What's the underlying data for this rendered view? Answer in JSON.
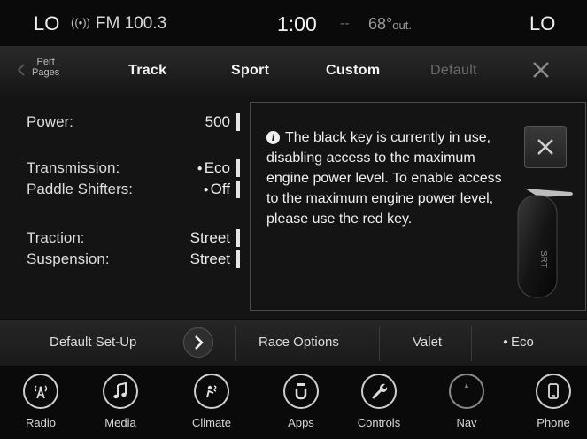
{
  "status": {
    "left_temp": "LO",
    "radio_source": "FM 100.3",
    "time": "1:00",
    "dash": "--",
    "outside_temp": "68°",
    "outside_label": "out.",
    "right_temp": "LO"
  },
  "tabs": {
    "perf_pages_line1": "Perf",
    "perf_pages_line2": "Pages",
    "items": [
      "Track",
      "Sport",
      "Custom",
      "Default"
    ]
  },
  "settings": {
    "power": {
      "label": "Power:",
      "value": "500"
    },
    "transmission": {
      "label": "Transmission:",
      "value": "Eco"
    },
    "paddle_shifters": {
      "label": "Paddle Shifters:",
      "value": "Off"
    },
    "traction": {
      "label": "Traction:",
      "value": "Street"
    },
    "suspension": {
      "label": "Suspension:",
      "value": "Street"
    }
  },
  "popup": {
    "message": "The black key is currently in use, disabling access to the maximum engine power level. To enable access to the maximum engine power level, please use the red key."
  },
  "actions": {
    "default_setup": "Default Set-Up",
    "race_options": "Race Options",
    "valet": "Valet",
    "eco": "Eco"
  },
  "nav": [
    "Radio",
    "Media",
    "Climate",
    "Apps",
    "Controls",
    "Nav",
    "Phone"
  ],
  "colors": {
    "background": "#0c0c0c",
    "text": "#e8e8e8",
    "disabled": "#6b6b6b"
  }
}
